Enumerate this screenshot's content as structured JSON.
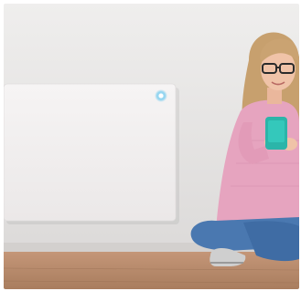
{
  "scene": {
    "subject": "woman-sitting-with-phone",
    "heater_indicator": "power-indicator-icon",
    "colors": {
      "wall": "#e9e7e6",
      "floor": "#b98c6a",
      "heater_panel": "#f3f1f1",
      "indicator": "#8fd3ef",
      "sweater": "#e6a4bf",
      "jeans": "#4a78b0",
      "hair": "#c7a06e",
      "phone": "#2bb5a9",
      "skin": "#f0c3a8"
    }
  }
}
